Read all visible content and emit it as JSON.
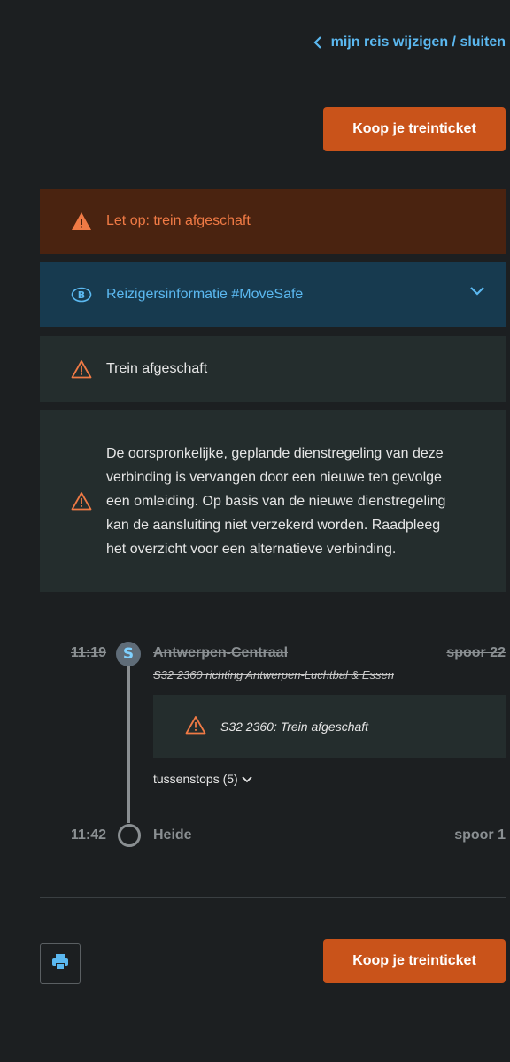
{
  "nav": {
    "back_label": "mijn reis wijzigen / sluiten"
  },
  "actions": {
    "buy_label": "Koop je treinticket"
  },
  "alerts": {
    "warning_banner": "Let op: trein afgeschaft",
    "info_label": "Reizigersinformatie #MoveSafe",
    "cancel_label": "Trein afgeschaft",
    "detail_text": "De oorspronkelijke, geplande dienstregeling van deze verbinding is vervangen door een nieuwe ten gevolge een omleiding. Op basis van de nieuwe dienstregeling kan de aansluiting niet verzekerd worden. Raadpleeg het overzicht voor een alternatieve verbinding."
  },
  "journey": {
    "departure": {
      "time": "11:19",
      "station": "Antwerpen-Centraal",
      "platform": "spoor 22"
    },
    "train_badge": "S",
    "direction": "S32 2360 richting Antwerpen-Luchtbal & Essen",
    "cancel_notice": "S32 2360: Trein afgeschaft",
    "stops_toggle": "tussenstops (5)",
    "arrival": {
      "time": "11:42",
      "station": "Heide",
      "platform": "spoor 1"
    }
  },
  "colors": {
    "accent": "#c9531a",
    "link": "#5bb8f0",
    "warning": "#f07a45",
    "info_bg": "#173a4f",
    "alert_bg": "#4a2310"
  }
}
